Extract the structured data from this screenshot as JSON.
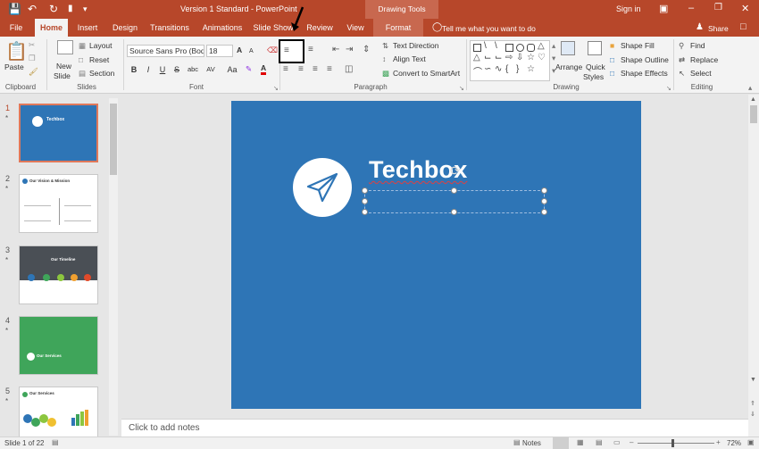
{
  "window": {
    "title": "Version 1 Standard  -  PowerPoint",
    "drawing_tools": "Drawing Tools",
    "sign_in": "Sign in"
  },
  "tabs": [
    "File",
    "Home",
    "Insert",
    "Design",
    "Transitions",
    "Animations",
    "Slide Show",
    "Review",
    "View",
    "Format"
  ],
  "tell_me": "Tell me what you want to do",
  "share": "Share",
  "ribbon": {
    "clipboard": {
      "paste": "Paste",
      "label": "Clipboard"
    },
    "slides": {
      "new_slide": "New",
      "new_slide2": "Slide",
      "layout": "Layout",
      "reset": "Reset",
      "section": "Section",
      "label": "Slides"
    },
    "font": {
      "family": "Source Sans Pro (Bod",
      "size": "18",
      "bold": "B",
      "italic": "I",
      "underline": "U",
      "strike": "S",
      "shadow": "abc",
      "spacing": "AV",
      "case": "Aa",
      "grow": "A",
      "shrink": "A",
      "label": "Font"
    },
    "paragraph": {
      "text_direction": "Text Direction",
      "align_text": "Align Text",
      "smartart": "Convert to SmartArt",
      "label": "Paragraph"
    },
    "drawing": {
      "arrange": "Arrange",
      "quick_styles": "Quick",
      "quick_styles2": "Styles",
      "shape_fill": "Shape Fill",
      "shape_outline": "Shape Outline",
      "shape_effects": "Shape Effects",
      "label": "Drawing"
    },
    "editing": {
      "find": "Find",
      "replace": "Replace",
      "select": "Select",
      "label": "Editing"
    }
  },
  "thumbnails": [
    {
      "num": "1",
      "title": "Techbox"
    },
    {
      "num": "2",
      "title": "Our Vision & Mission"
    },
    {
      "num": "3",
      "title": "Our Timeline"
    },
    {
      "num": "4",
      "title": "Our Services"
    },
    {
      "num": "5",
      "title": "Our Services"
    }
  ],
  "slide": {
    "title": "Techbox",
    "bg": "#2e75b6"
  },
  "notes_placeholder": "Click to add notes",
  "status": {
    "slide": "Slide 1 of 22",
    "notes": "Notes",
    "zoom": "72%"
  },
  "colors": {
    "accent": "#b7472a",
    "slide_blue": "#2e75b6",
    "green": "#3fa55a",
    "gray": "#4a4f55"
  }
}
